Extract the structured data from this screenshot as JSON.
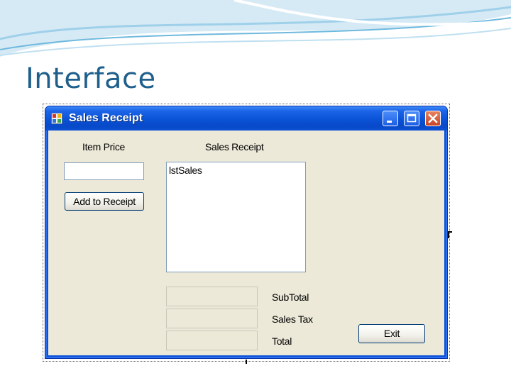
{
  "slide": {
    "title": "Interface"
  },
  "window": {
    "title": "Sales Receipt",
    "icon": "form-icon",
    "controls": [
      "minimize-icon",
      "maximize-icon",
      "close-icon"
    ]
  },
  "form": {
    "item_price_label": "Item Price",
    "item_price_value": "",
    "add_button_label": "Add to Receipt",
    "sales_receipt_label": "Sales Receipt",
    "list_items": [
      "lstSales"
    ],
    "subtotal_label": "SubTotal",
    "subtotal_value": "",
    "sales_tax_label": "Sales Tax",
    "sales_tax_value": "",
    "total_label": "Total",
    "total_value": "",
    "exit_button_label": "Exit"
  },
  "colors": {
    "titlebar": "#0a52d6",
    "client": "#ece9d8",
    "slide_title": "#1f5f8b",
    "close_button": "#c84425"
  }
}
